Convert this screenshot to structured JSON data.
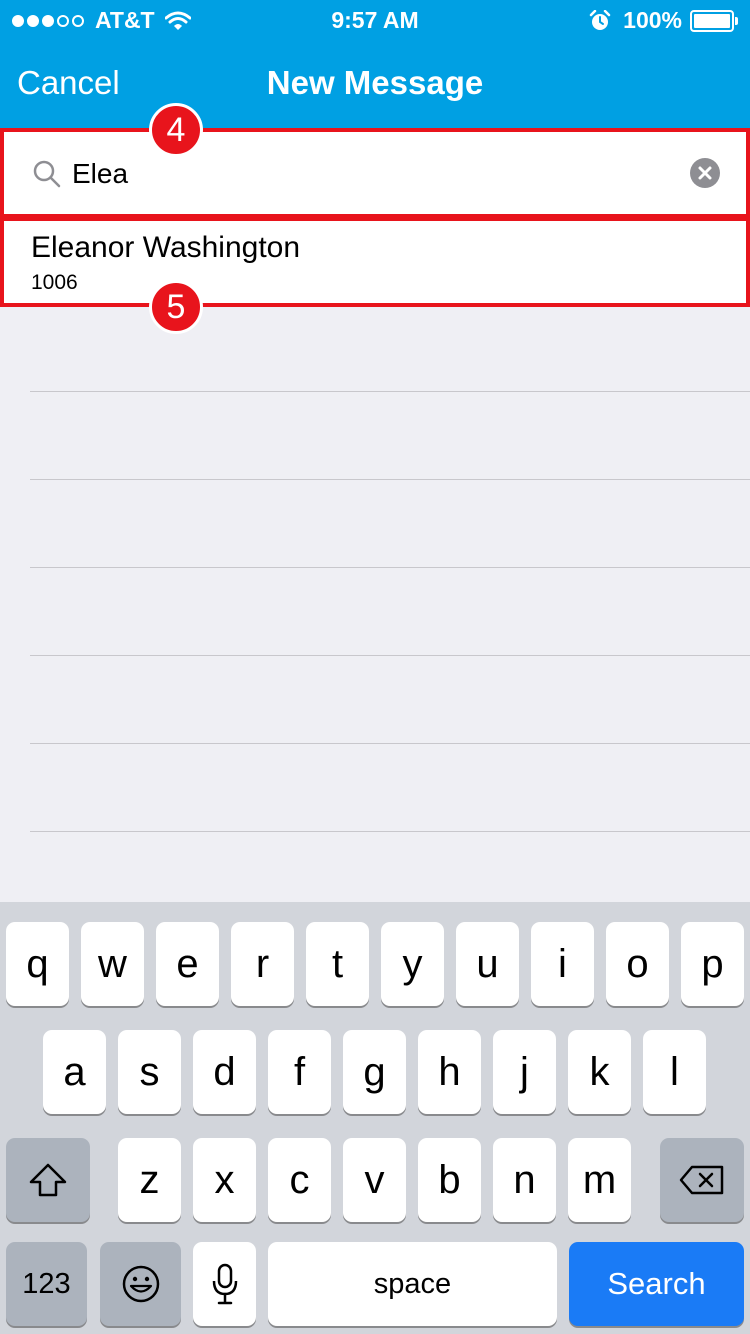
{
  "status_bar": {
    "carrier": "AT&T",
    "time": "9:57 AM",
    "battery": "100%",
    "signal_dots_filled": 3,
    "signal_dots_total": 5
  },
  "nav": {
    "cancel_label": "Cancel",
    "title": "New Message"
  },
  "search": {
    "value": "Elea"
  },
  "results": [
    {
      "name": "Eleanor Washington",
      "extension": "1006"
    }
  ],
  "callouts": {
    "search": "4",
    "result": "5"
  },
  "keyboard": {
    "row1": [
      "q",
      "w",
      "e",
      "r",
      "t",
      "y",
      "u",
      "i",
      "o",
      "p"
    ],
    "row2": [
      "a",
      "s",
      "d",
      "f",
      "g",
      "h",
      "j",
      "k",
      "l"
    ],
    "row3": [
      "z",
      "x",
      "c",
      "v",
      "b",
      "n",
      "m"
    ],
    "numbers_label": "123",
    "space_label": "space",
    "search_label": "Search"
  },
  "colors": {
    "nav_background": "#00a0e3",
    "highlight_border": "#e8141c",
    "search_key": "#1a7bf6",
    "keyboard_background": "#d2d5db"
  }
}
